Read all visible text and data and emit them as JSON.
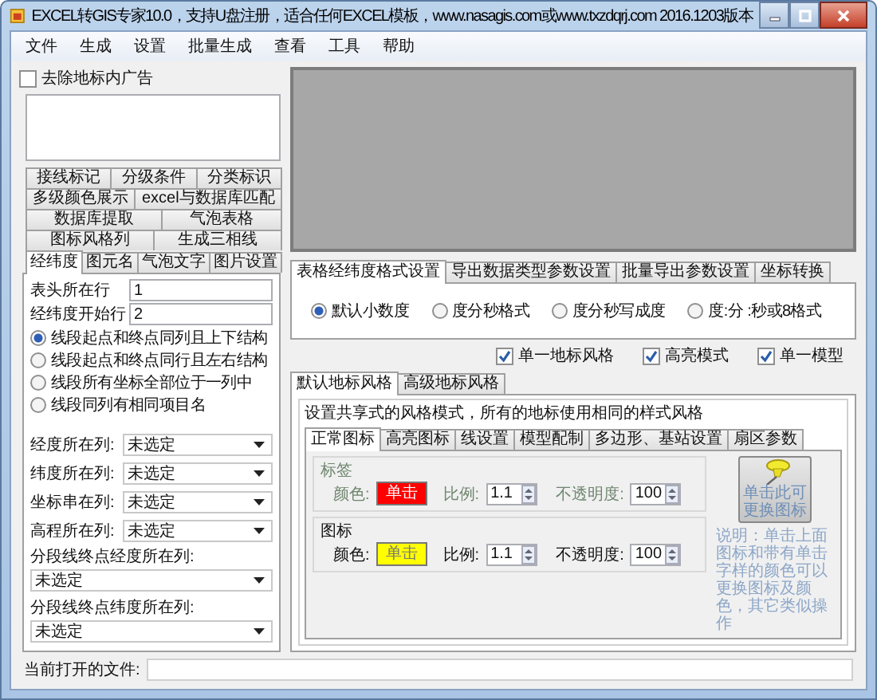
{
  "window": {
    "title": "EXCEL转GIS专家10.0，支持U盘注册，适合任何EXCEL模板，www.nasagis.com或www.txzdqrj.com 2016.1203版本"
  },
  "menu": [
    "文件",
    "生成",
    "设置",
    "批量生成",
    "查看",
    "工具",
    "帮助"
  ],
  "left": {
    "remove_ad": {
      "label": "去除地标内广告",
      "checked": false
    },
    "tab_rows": [
      {
        "tabs": [
          {
            "label": "接线标记",
            "selected": false
          },
          {
            "label": "分级条件",
            "selected": false
          },
          {
            "label": "分类标识",
            "selected": false
          }
        ]
      },
      {
        "tabs": [
          {
            "label": "多级颜色展示",
            "selected": false
          },
          {
            "label": "excel与数据库匹配",
            "selected": false
          }
        ]
      },
      {
        "tabs": [
          {
            "label": "数据库提取",
            "selected": false
          },
          {
            "label": "气泡表格",
            "selected": false
          }
        ]
      },
      {
        "tabs": [
          {
            "label": "图标风格列",
            "selected": false
          },
          {
            "label": "生成三相线",
            "selected": false
          }
        ]
      },
      {
        "tabs": [
          {
            "label": "经纬度",
            "selected": true
          },
          {
            "label": "图元名",
            "selected": false
          },
          {
            "label": "气泡文字",
            "selected": false
          },
          {
            "label": "图片设置",
            "selected": false
          }
        ]
      }
    ],
    "fields": [
      {
        "label": "表头所在行",
        "value": "1"
      },
      {
        "label": "经纬度开始行",
        "value": "2"
      }
    ],
    "radios": [
      {
        "label": "线段起点和终点同列且上下结构",
        "selected": true
      },
      {
        "label": "线段起点和终点同行且左右结构",
        "selected": false
      },
      {
        "label": "线段所有坐标全部位于一列中",
        "selected": false
      },
      {
        "label": "线段同列有相同项目名",
        "selected": false
      }
    ],
    "dropdowns": [
      {
        "kind": "inline",
        "label": "经度所在列:",
        "value": "未选定"
      },
      {
        "kind": "inline",
        "label": "纬度所在列:",
        "value": "未选定"
      },
      {
        "kind": "inline",
        "label": "坐标串在列:",
        "value": "未选定"
      },
      {
        "kind": "inline",
        "label": "高程所在列:",
        "value": "未选定"
      },
      {
        "kind": "stacked",
        "label": "分段线终点经度所在列:",
        "value": "未选定"
      },
      {
        "kind": "stacked",
        "label": "分段线终点纬度所在列:",
        "value": "未选定"
      }
    ]
  },
  "format_tabs": [
    {
      "label": "表格经纬度格式设置",
      "selected": true
    },
    {
      "label": "导出数据类型参数设置",
      "selected": false
    },
    {
      "label": "批量导出参数设置",
      "selected": false
    },
    {
      "label": "坐标转换",
      "selected": false
    }
  ],
  "format_radios": [
    {
      "label": "默认小数度",
      "selected": true
    },
    {
      "label": "度分秒格式",
      "selected": false
    },
    {
      "label": "度分秒写成度",
      "selected": false
    },
    {
      "label": "度:分 :秒或8格式",
      "selected": false
    }
  ],
  "options": [
    {
      "label": "单一地标风格",
      "checked": true
    },
    {
      "label": "高亮模式",
      "checked": true
    },
    {
      "label": "单一模型",
      "checked": true
    }
  ],
  "style_tabs": [
    {
      "label": "默认地标风格",
      "selected": true
    },
    {
      "label": "高级地标风格",
      "selected": false
    }
  ],
  "style_group": {
    "legend": "设置共享式的风格模式，所有的地标使用相同的样式风格",
    "icon_tabs": [
      {
        "label": "正常图标",
        "selected": true
      },
      {
        "label": "高亮图标",
        "selected": false
      },
      {
        "label": "线设置",
        "selected": false
      },
      {
        "label": "模型配制",
        "selected": false
      },
      {
        "label": "多边形、基站设置",
        "selected": false
      },
      {
        "label": "扇区参数",
        "selected": false
      }
    ],
    "groups": [
      {
        "legend": "标签",
        "disabled": true,
        "color_label": "颜色:",
        "color_button": "单击",
        "color": "#ff0000",
        "scale_label": "比例:",
        "scale": "1.1",
        "opacity_label": "不透明度:",
        "opacity": "100"
      },
      {
        "legend": "图标",
        "disabled": false,
        "color_label": "颜色:",
        "color_button": "单击",
        "color": "#ffff00",
        "scale_label": "比例:",
        "scale": "1.1",
        "opacity_label": "不透明度:",
        "opacity": "100"
      }
    ],
    "pin_button": "单击此可更换图标",
    "note": "说明：单击上面图标和带有单击字样的颜色可以更换图标及颜色，其它类似操作"
  },
  "status": {
    "label": "当前打开的文件:"
  }
}
